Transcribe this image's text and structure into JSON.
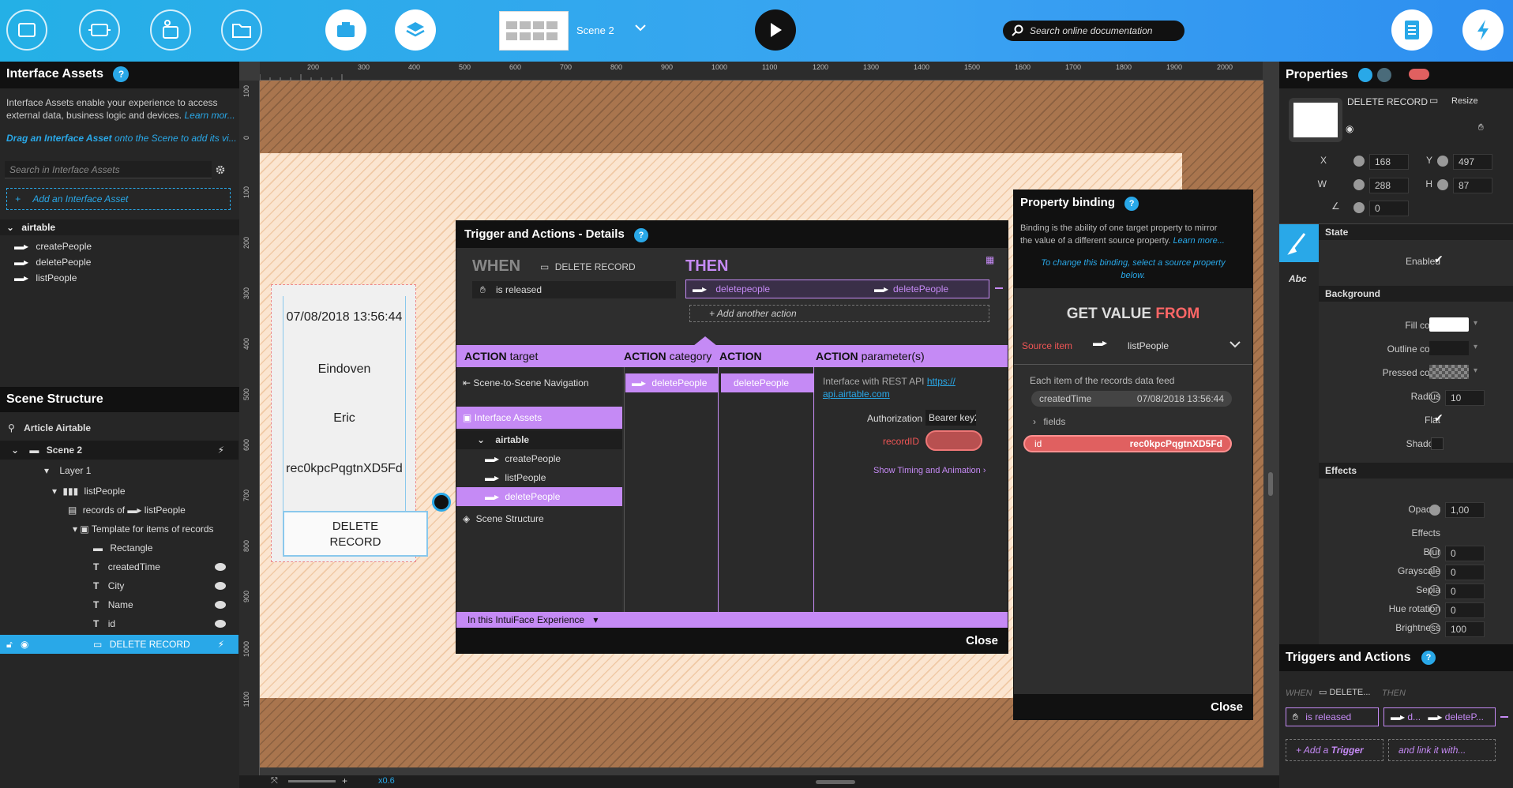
{
  "toolbar": {
    "scene_name": "Scene 2",
    "search_placeholder": "Search online documentation"
  },
  "interface_assets": {
    "title": "Interface Assets",
    "help": "?",
    "desc_line1": "Interface Assets enable your experience to access",
    "desc_line2": "external data, business logic and devices.",
    "learn_more": "Learn mor...",
    "drag_hint_bold": "Drag an Interface Asset",
    "drag_hint_rest": "onto the Scene to add its vi...",
    "search_placeholder": "Search in Interface Assets",
    "add_label": "Add an Interface Asset",
    "group": "airtable",
    "items": [
      "createPeople",
      "deletePeople",
      "listPeople"
    ]
  },
  "scene_structure": {
    "title": "Scene Structure",
    "project": "Article Airtable",
    "scene": "Scene 2",
    "layer": "Layer 1",
    "list": "listPeople",
    "records_of": "records of",
    "records_source": "listPeople",
    "template": "Template for items of records",
    "children": [
      "Rectangle",
      "createdTime",
      "City",
      "Name",
      "id",
      "DELETE  RECORD"
    ]
  },
  "canvas": {
    "ruler_top": [
      "200",
      "300",
      "400",
      "500",
      "600",
      "700",
      "800",
      "900",
      "1000",
      "1100",
      "1200",
      "1300",
      "1400",
      "1500",
      "1600",
      "1700",
      "1800",
      "1900",
      "2000"
    ],
    "ruler_left": [
      "100",
      "0",
      "100",
      "200",
      "300",
      "400",
      "500",
      "600",
      "700",
      "800",
      "900",
      "1000",
      "1100"
    ],
    "card": {
      "time": "07/08/2018 13:56:44",
      "city": "Eindoven",
      "name": "Eric",
      "id": "rec0kpcPqgtnXD5Fd",
      "button_line1": "DELETE",
      "button_line2": "RECORD"
    },
    "zoom": "x0.6"
  },
  "trigger_dialog": {
    "title": "Trigger and Actions - Details",
    "help": "?",
    "when": "WHEN",
    "when_item": "DELETE  RECORD",
    "then": "THEN",
    "trigger": "is released",
    "action_left": "deletepeople",
    "action_right": "deletePeople",
    "add_action": "Add another action",
    "col_target_bold": "ACTION",
    "col_target": "target",
    "col_category_bold": "ACTION",
    "col_category": "category",
    "col_action": "ACTION",
    "col_params_bold": "ACTION",
    "col_params": "parameter(s)",
    "targets": {
      "nav": "Scene-to-Scene Navigation",
      "assets": "Interface Assets",
      "group": "airtable",
      "items": [
        "createPeople",
        "listPeople",
        "deletePeople"
      ],
      "scene_structure": "Scene Structure"
    },
    "category": "deletePeople",
    "action": "deletePeople",
    "param_desc": "Interface with REST API",
    "param_link1": "https://",
    "param_link2": "api.airtable.com",
    "auth_label": "Authorization",
    "auth_value": "Bearer key2",
    "record_label": "recordID",
    "show_timing": "Show Timing and Animation",
    "footer": "In this IntuiFace Experience",
    "close": "Close"
  },
  "binding_dialog": {
    "title": "Property binding",
    "help": "?",
    "desc_line1": "Binding is the ability of one target property to mirror",
    "desc_line2": "the value of a different source property.",
    "learn_more": "Learn more...",
    "hint_line1": "To change this binding, select a source property",
    "hint_line2": "below.",
    "get_value": "GET VALUE",
    "from": "FROM",
    "source_label": "Source item",
    "source_value": "listPeople",
    "feed_label": "Each item of the records data feed",
    "field1": "createdTime",
    "field1_value": "07/08/2018 13:56:44",
    "fields": "fields",
    "field_id": "id",
    "field_id_value": "rec0kpcPqgtnXD5Fd",
    "close": "Close"
  },
  "properties": {
    "title": "Properties",
    "item_name": "DELETE  RECORD",
    "resize": "Resize",
    "x": "168",
    "y": "497",
    "w": "288",
    "h": "87",
    "angle": "0",
    "x_label": "X",
    "y_label": "Y",
    "w_label": "W",
    "h_label": "H",
    "state": "State",
    "enabled": "Enabled",
    "background": "Background",
    "fill": "Fill color",
    "outline": "Outline color",
    "pressed": "Pressed color",
    "radius": "Radius",
    "radius_value": "10",
    "flat": "Flat",
    "shadow": "Shadow",
    "effects": "Effects",
    "opacity": "Opacity",
    "opacity_value": "1,00",
    "effects_sub": "Effects",
    "blur": "Blur",
    "blur_value": "0",
    "grayscale": "Grayscale",
    "grayscale_value": "0",
    "sepia": "Sepia",
    "sepia_value": "0",
    "hue": "Hue rotation",
    "hue_value": "0",
    "brightness": "Brightness",
    "brightness_value": "100",
    "text_tab": "Abc"
  },
  "triggers_panel": {
    "title": "Triggers and Actions",
    "help": "?",
    "when": "WHEN",
    "item": "DELETE...",
    "then": "THEN",
    "trigger": "is released",
    "action1": "d...",
    "action2": "deleteP...",
    "add_trigger_pre": "Add a",
    "add_trigger": "Trigger",
    "link_it": "and link it with..."
  }
}
